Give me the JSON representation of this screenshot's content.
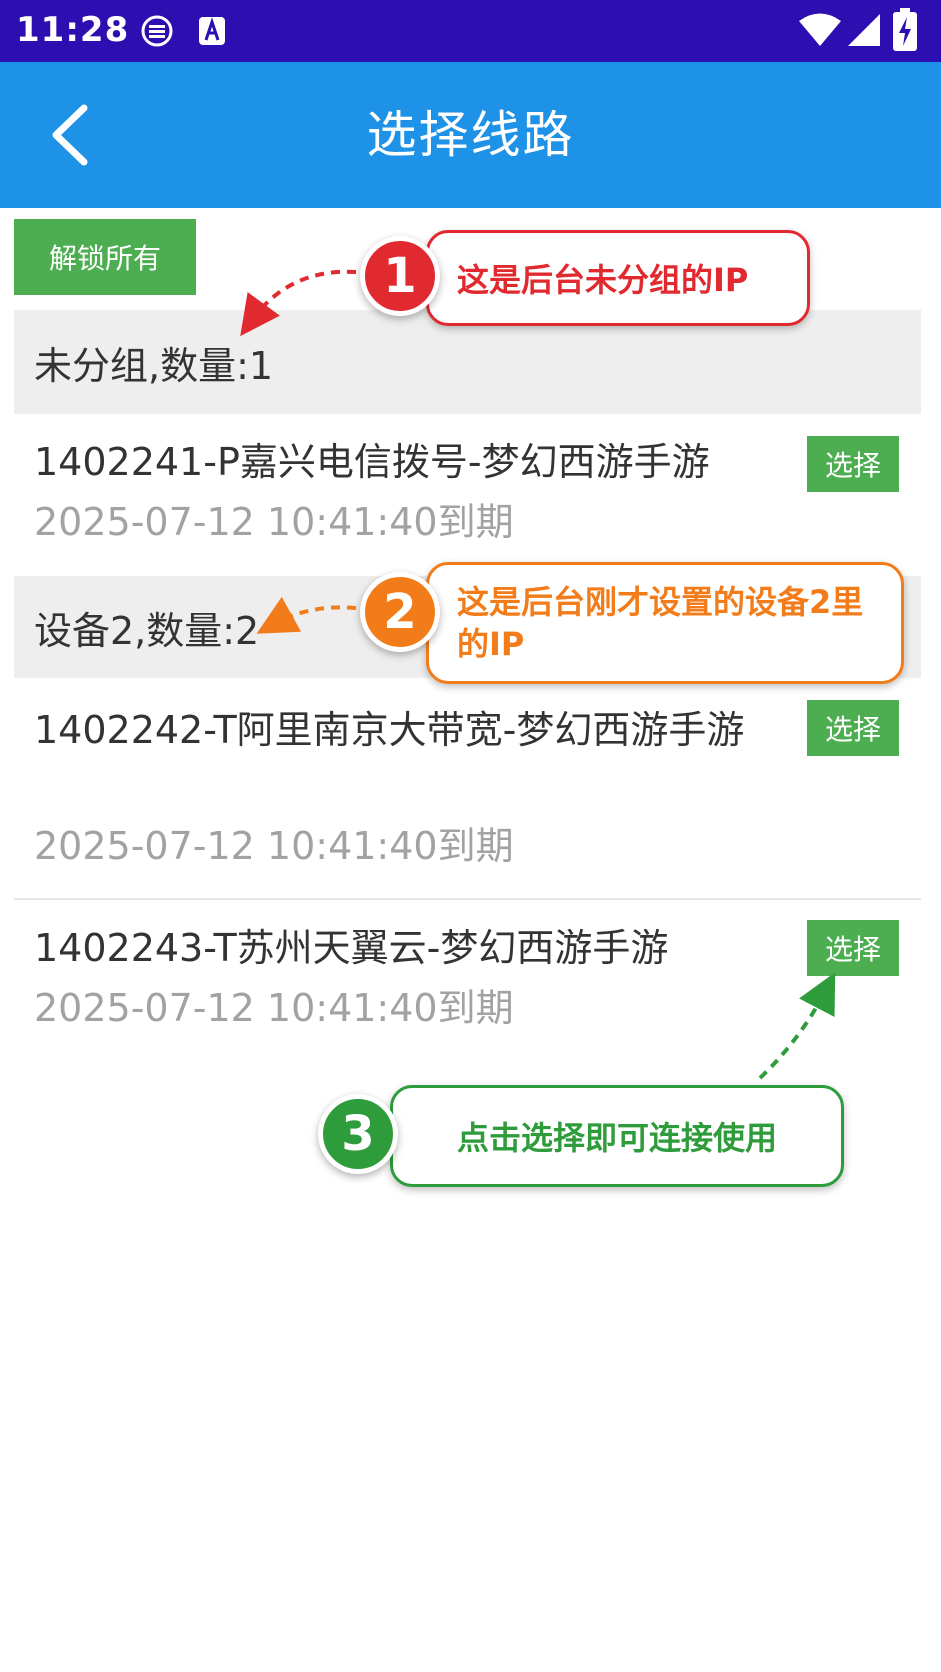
{
  "status_bar": {
    "time": "11:28"
  },
  "app_bar": {
    "title": "选择线路"
  },
  "unlock_all_label": "解锁所有",
  "groups": [
    {
      "header": "未分组,数量:1",
      "items": [
        {
          "name": "1402241-P嘉兴电信拨号-梦幻西游手游",
          "expire": "2025-07-12 10:41:40到期",
          "button": "选择"
        }
      ]
    },
    {
      "header": "设备2,数量:2",
      "items": [
        {
          "name": "1402242-T阿里南京大带宽-梦幻西游手游",
          "expire": "2025-07-12 10:41:40到期",
          "button": "选择"
        },
        {
          "name": "1402243-T苏州天翼云-梦幻西游手游",
          "expire": "2025-07-12 10:41:40到期",
          "button": "选择"
        }
      ]
    }
  ],
  "annotations": [
    {
      "number": "1",
      "text": "这是后台未分组的IP",
      "color": "#e02a2f"
    },
    {
      "number": "2",
      "text": "这是后台刚才设置的设备2里的IP",
      "color": "#f37c1a"
    },
    {
      "number": "3",
      "text": "点击选择即可连接使用",
      "color": "#2e9c3a"
    }
  ],
  "colors": {
    "status_bar": "#2d0eb0",
    "app_bar": "#1e92e6",
    "button_green": "#4cae50",
    "group_header_bg": "#eeeeee"
  },
  "icons": {
    "back": "chevron-left-icon",
    "wifi": "wifi-icon",
    "signal": "cell-signal-icon",
    "battery": "battery-charging-icon"
  }
}
